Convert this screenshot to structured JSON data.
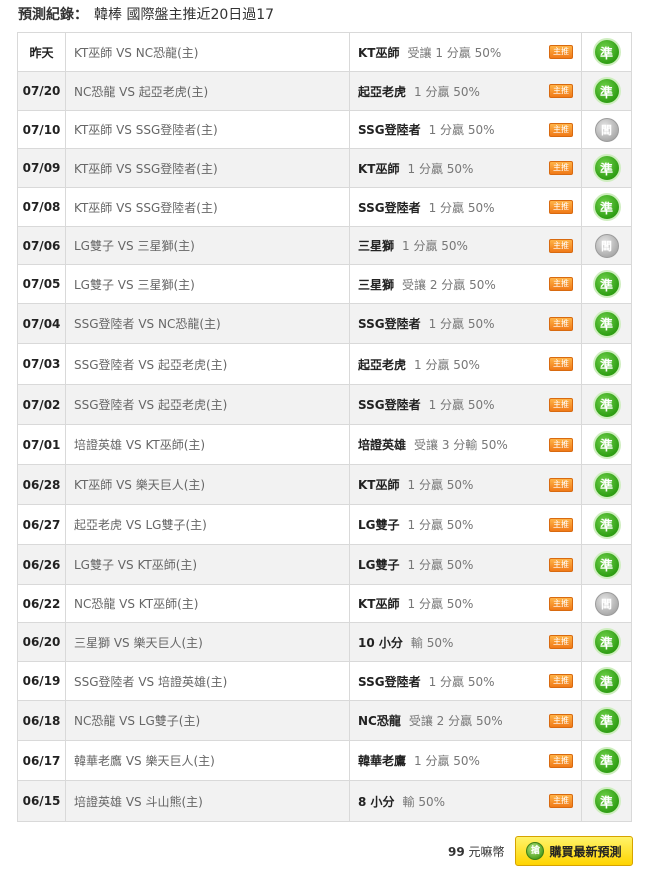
{
  "header": {
    "label": "預測紀錄",
    "separator": "：",
    "text": "韓棒 國際盤主推近20日過17"
  },
  "colors": {
    "hit": "#2f9e14",
    "push": "#a9a9a9",
    "tag": "#f07a18",
    "buy_button": "#ffd400"
  },
  "rows": [
    {
      "date": "昨天",
      "match": "KT巫師 VS NC恐龍(主)",
      "team": "KT巫師",
      "odds": "受讓 1 分贏 50%",
      "tag": "主推",
      "result": "準",
      "status": "hit"
    },
    {
      "date": "07/20",
      "match": "NC恐龍 VS 起亞老虎(主)",
      "team": "起亞老虎",
      "odds": "1 分贏 50%",
      "tag": "主推",
      "result": "準",
      "status": "hit"
    },
    {
      "date": "07/10",
      "match": "KT巫師 VS SSG登陸者(主)",
      "team": "SSG登陸者",
      "odds": "1 分贏 50%",
      "tag": "主推",
      "result": "闆",
      "status": "push"
    },
    {
      "date": "07/09",
      "match": "KT巫師 VS SSG登陸者(主)",
      "team": "KT巫師",
      "odds": "1 分贏 50%",
      "tag": "主推",
      "result": "準",
      "status": "hit"
    },
    {
      "date": "07/08",
      "match": "KT巫師 VS SSG登陸者(主)",
      "team": "SSG登陸者",
      "odds": "1 分贏 50%",
      "tag": "主推",
      "result": "準",
      "status": "hit"
    },
    {
      "date": "07/06",
      "match": "LG雙子 VS 三星獅(主)",
      "team": "三星獅",
      "odds": "1 分贏 50%",
      "tag": "主推",
      "result": "闆",
      "status": "push"
    },
    {
      "date": "07/05",
      "match": "LG雙子 VS 三星獅(主)",
      "team": "三星獅",
      "odds": "受讓 2 分贏 50%",
      "tag": "主推",
      "result": "準",
      "status": "hit"
    },
    {
      "date": "07/04",
      "match": "SSG登陸者 VS NC恐龍(主)",
      "team": "SSG登陸者",
      "odds": "1 分贏 50%",
      "tag": "主推",
      "result": "準",
      "status": "hit"
    },
    {
      "date": "07/03",
      "match": "SSG登陸者 VS 起亞老虎(主)",
      "team": "起亞老虎",
      "odds": "1 分贏 50%",
      "tag": "主推",
      "result": "準",
      "status": "hit"
    },
    {
      "date": "07/02",
      "match": "SSG登陸者 VS 起亞老虎(主)",
      "team": "SSG登陸者",
      "odds": "1 分贏 50%",
      "tag": "主推",
      "result": "準",
      "status": "hit"
    },
    {
      "date": "07/01",
      "match": "培證英雄 VS KT巫師(主)",
      "team": "培證英雄",
      "odds": "受讓 3 分輸 50%",
      "tag": "主推",
      "result": "準",
      "status": "hit"
    },
    {
      "date": "06/28",
      "match": "KT巫師 VS 樂天巨人(主)",
      "team": "KT巫師",
      "odds": "1 分贏 50%",
      "tag": "主推",
      "result": "準",
      "status": "hit"
    },
    {
      "date": "06/27",
      "match": "起亞老虎 VS LG雙子(主)",
      "team": "LG雙子",
      "odds": "1 分贏 50%",
      "tag": "主推",
      "result": "準",
      "status": "hit"
    },
    {
      "date": "06/26",
      "match": "LG雙子 VS KT巫師(主)",
      "team": "LG雙子",
      "odds": "1 分贏 50%",
      "tag": "主推",
      "result": "準",
      "status": "hit"
    },
    {
      "date": "06/22",
      "match": "NC恐龍 VS KT巫師(主)",
      "team": "KT巫師",
      "odds": "1 分贏 50%",
      "tag": "主推",
      "result": "闆",
      "status": "push"
    },
    {
      "date": "06/20",
      "match": "三星獅 VS 樂天巨人(主)",
      "team": "10 小分",
      "odds": "輸 50%",
      "tag": "主推",
      "result": "準",
      "status": "hit"
    },
    {
      "date": "06/19",
      "match": "SSG登陸者 VS 培證英雄(主)",
      "team": "SSG登陸者",
      "odds": "1 分贏 50%",
      "tag": "主推",
      "result": "準",
      "status": "hit"
    },
    {
      "date": "06/18",
      "match": "NC恐龍 VS LG雙子(主)",
      "team": "NC恐龍",
      "odds": "受讓 2 分贏 50%",
      "tag": "主推",
      "result": "準",
      "status": "hit"
    },
    {
      "date": "06/17",
      "match": "韓華老鷹 VS 樂天巨人(主)",
      "team": "韓華老鷹",
      "odds": "1 分贏 50%",
      "tag": "主推",
      "result": "準",
      "status": "hit"
    },
    {
      "date": "06/15",
      "match": "培證英雄 VS 斗山熊(主)",
      "team": "8 小分",
      "odds": "輸 50%",
      "tag": "主推",
      "result": "準",
      "status": "hit"
    }
  ],
  "footer": {
    "price": "99",
    "currency": "元嘛幣",
    "buy_icon": "搶",
    "buy_label": "購買最新預測"
  }
}
